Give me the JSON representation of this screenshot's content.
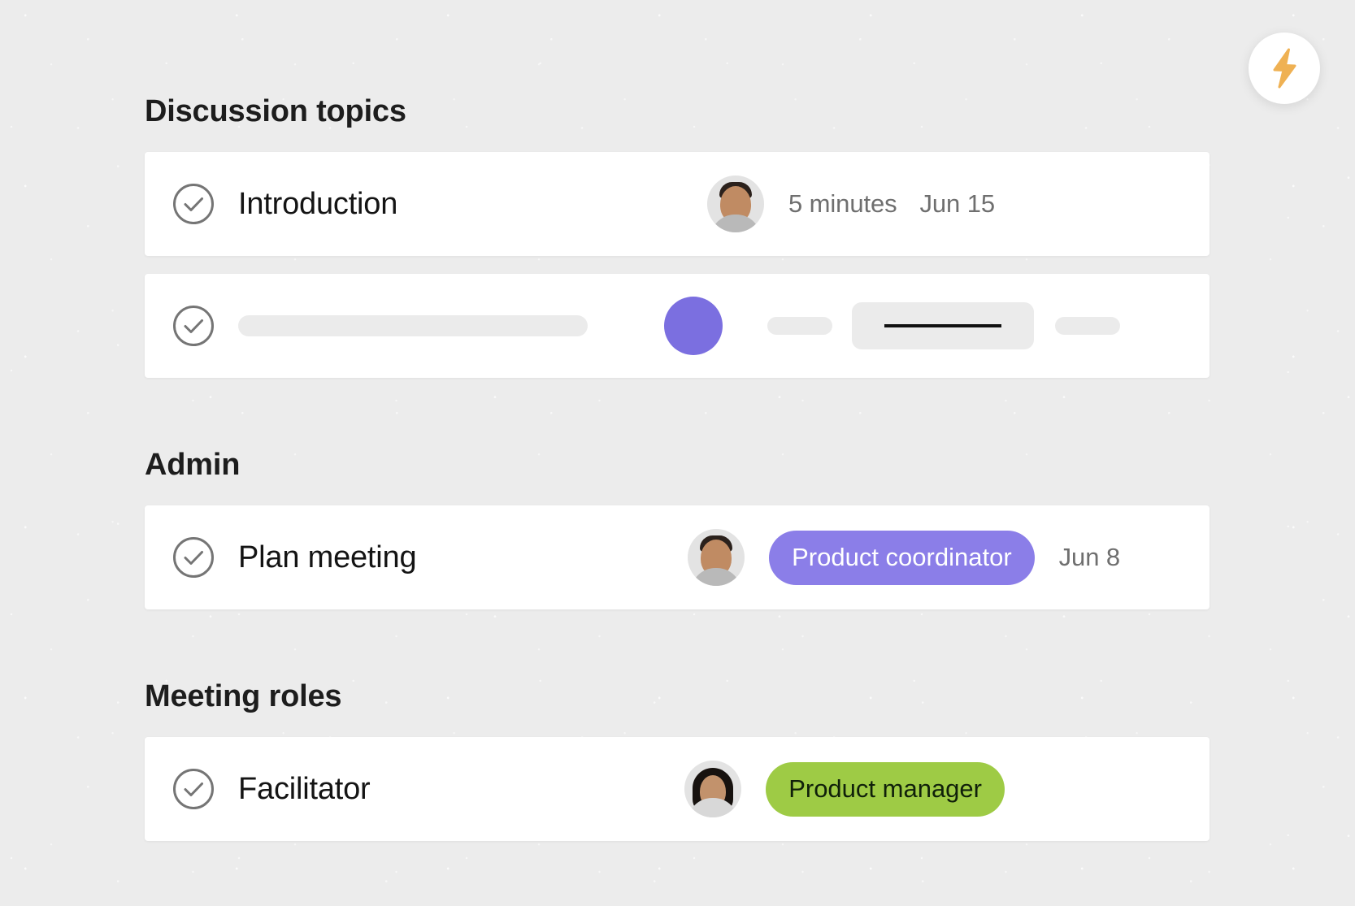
{
  "theme": {
    "background": "#ececec",
    "card_background": "#ffffff",
    "accent_purple": "#8b7ee8",
    "accent_green": "#9ecb45",
    "bolt_orange": "#efb153",
    "text_primary": "#141414",
    "text_muted": "#6f6f6f",
    "skeleton_gray": "#ebebeb"
  },
  "fab": {
    "icon": "lightning-bolt-icon",
    "color": "#efb153"
  },
  "sections": [
    {
      "title": "Discussion topics",
      "rows": [
        {
          "type": "task",
          "status_icon": "check-circle-icon",
          "label": "Introduction",
          "avatar": "male",
          "duration": "5 minutes",
          "date": "Jun 15"
        },
        {
          "type": "skeleton",
          "status_icon": "check-circle-icon",
          "placeholders": [
            "title-bar",
            "purple-dot",
            "small-bar",
            "input-field-with-caret",
            "tiny-bar"
          ]
        }
      ]
    },
    {
      "title": "Admin",
      "rows": [
        {
          "type": "task",
          "status_icon": "check-circle-icon",
          "label": "Plan meeting",
          "avatar": "male",
          "badge": {
            "label": "Product coordinator",
            "color": "purple"
          },
          "date": "Jun 8"
        }
      ]
    },
    {
      "title": "Meeting roles",
      "rows": [
        {
          "type": "task",
          "status_icon": "check-circle-icon",
          "label": "Facilitator",
          "avatar": "female",
          "badge": {
            "label": "Product manager",
            "color": "green"
          }
        }
      ]
    }
  ]
}
